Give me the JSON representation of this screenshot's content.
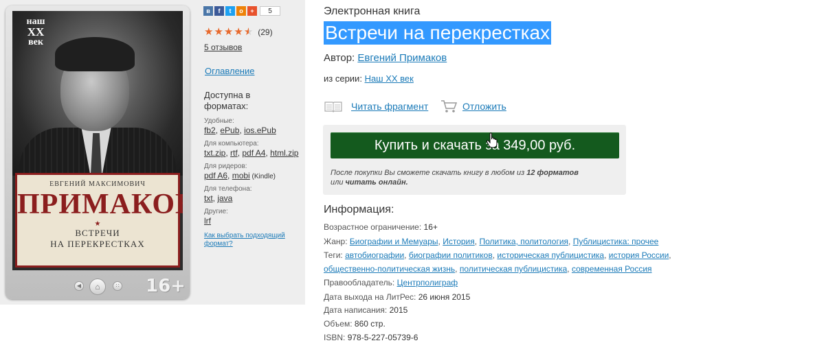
{
  "social": {
    "icons": [
      {
        "name": "vk-icon",
        "glyph": "в",
        "color": "#4a76a8"
      },
      {
        "name": "facebook-icon",
        "glyph": "f",
        "color": "#3b5998"
      },
      {
        "name": "twitter-icon",
        "glyph": "t",
        "color": "#1da1f2"
      },
      {
        "name": "odnoklassniki-icon",
        "glyph": "о",
        "color": "#ee8208"
      },
      {
        "name": "more-share-icon",
        "glyph": "+",
        "color": "#e8522c"
      }
    ],
    "share_count": "5"
  },
  "cover": {
    "series_logo": {
      "line1": "наш",
      "line2": "XX",
      "line3": "век"
    },
    "author_firstname": "ЕВГЕНИЙ МАКСИМОВИЧ",
    "author_lastname": "ПРИМАКОВ",
    "title_line1": "ВСТРЕЧИ",
    "title_line2": "НА ПЕРЕКРЕСТКАХ",
    "age_badge": "16+"
  },
  "rating": {
    "stars": "★★★★★",
    "value_fraction": 0.9,
    "count": "(29)",
    "reviews": "5 отзывов"
  },
  "toc_link": "Оглавление",
  "formats": {
    "title": "Доступна в форматах:",
    "groups": [
      {
        "label": "Удобные:",
        "items": [
          "fb2",
          "ePub",
          "ios.ePub"
        ]
      },
      {
        "label": "Для компьютера:",
        "items": [
          "txt.zip",
          "rtf",
          "pdf A4",
          "html.zip"
        ]
      },
      {
        "label": "Для ридеров:",
        "items": [
          "pdf A6",
          "mobi"
        ],
        "extra": "(Kindle)"
      },
      {
        "label": "Для телефона:",
        "items": [
          "txt",
          "java"
        ]
      },
      {
        "label": "Другие:",
        "items": [
          "lrf"
        ]
      }
    ],
    "help_link": "Как выбрать подходящий формат?"
  },
  "book": {
    "type_label": "Электронная книга",
    "title": "Встречи на перекрестках",
    "author_label": "Автор:",
    "author": "Евгений Примаков",
    "series_label": "из серии:",
    "series": "Наш XX век"
  },
  "actions": {
    "read_fragment": "Читать фрагмент",
    "defer": "Отложить"
  },
  "buy": {
    "button_label": "Купить и скачать за 349,00 руб.",
    "note_part1": "После покупки Вы сможете скачать книгу в любом из ",
    "note_bold1": "12 форматов",
    "note_part2": "или ",
    "note_bold2": "читать онлайн."
  },
  "info": {
    "title": "Информация:",
    "age_label": "Возрастное ограничение:",
    "age_value": "16+",
    "genre_label": "Жанр:",
    "genres": [
      "Биографии и Мемуары",
      "История",
      "Политика, политология",
      "Публицистика: прочее"
    ],
    "tags_label": "Теги:",
    "tags_line1": [
      "автобиографии",
      "биографии политиков",
      "историческая публицистика",
      "история России"
    ],
    "tags_line2": [
      "общественно-политическая жизнь",
      "политическая публицистика",
      "современная Россия"
    ],
    "rightsholder_label": "Правообладатель:",
    "rightsholder": "Центрполиграф",
    "release_label": "Дата выхода на ЛитРес:",
    "release_value": "26 июня 2015",
    "written_label": "Дата написания:",
    "written_value": "2015",
    "volume_label": "Объем:",
    "volume_value": "860 стр.",
    "isbn_label": "ISBN:",
    "isbn_value": "978-5-227-05739-6"
  }
}
